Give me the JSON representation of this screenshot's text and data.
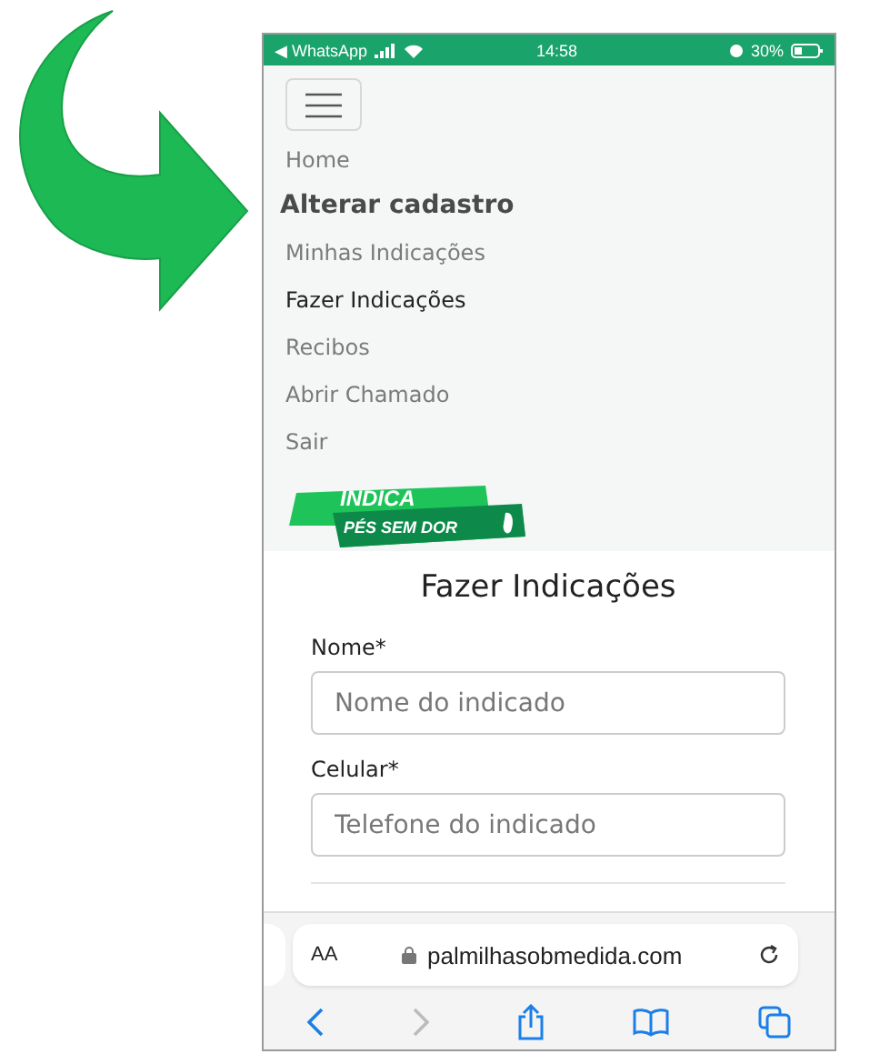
{
  "status_bar": {
    "back_app": "◀ WhatsApp",
    "time": "14:58",
    "battery": "30%"
  },
  "menu": {
    "items": [
      {
        "label": "Home",
        "kind": "link",
        "selected": false
      },
      {
        "label": "Alterar cadastro",
        "kind": "heading",
        "selected": false
      },
      {
        "label": "Minhas Indicações",
        "kind": "link",
        "selected": false
      },
      {
        "label": "Fazer Indicações",
        "kind": "link",
        "selected": true
      },
      {
        "label": "Recibos",
        "kind": "link",
        "selected": false
      },
      {
        "label": "Abrir Chamado",
        "kind": "link",
        "selected": false
      },
      {
        "label": "Sair",
        "kind": "link",
        "selected": false
      }
    ]
  },
  "logo": {
    "line_1": "INDICA",
    "line_2": "PÉS SEM DOR"
  },
  "form": {
    "title": "Fazer Indicações",
    "fields": [
      {
        "label": "Nome*",
        "placeholder": "Nome do indicado"
      },
      {
        "label": "Celular*",
        "placeholder": "Telefone do indicado"
      }
    ]
  },
  "browser": {
    "text_size": "AA",
    "url": "palmilhasobmedida.com"
  }
}
